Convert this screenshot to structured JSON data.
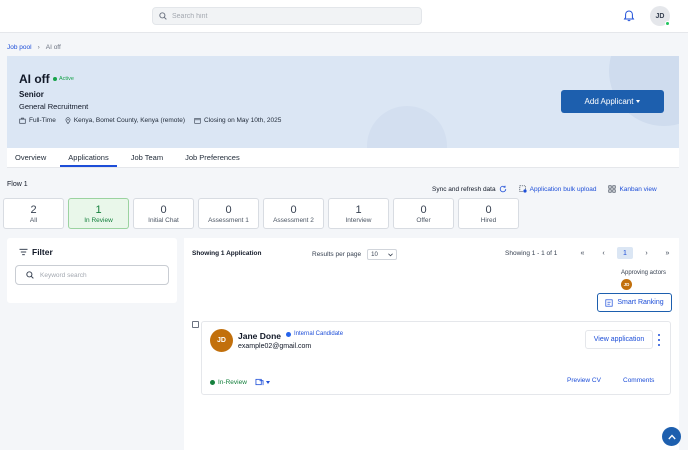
{
  "header": {
    "search_placeholder": "Search hint",
    "user_initials": "JD"
  },
  "breadcrumb": {
    "root": "Job pool",
    "separator": "›",
    "current": "AI off"
  },
  "job": {
    "title": "AI off",
    "status": "Active",
    "level": "Senior",
    "category": "General Recruitment",
    "employment_type": "Full-Time",
    "location": "Kenya, Bomet County, Kenya (remote)",
    "closing": "Closing on May 10th, 2025",
    "add_button": "Add Applicant"
  },
  "tabs": [
    {
      "label": "Overview",
      "active": false
    },
    {
      "label": "Applications",
      "active": true
    },
    {
      "label": "Job Team",
      "active": false
    },
    {
      "label": "Job Preferences",
      "active": false
    }
  ],
  "flow": {
    "label": "Flow 1",
    "sync": "Sync and refresh data",
    "bulk_upload": "Application bulk upload",
    "kanban": "Kanban view",
    "stages": [
      {
        "count": "2",
        "name": "All",
        "active": false
      },
      {
        "count": "1",
        "name": "In Review",
        "active": true
      },
      {
        "count": "0",
        "name": "Initial Chat",
        "active": false
      },
      {
        "count": "0",
        "name": "Assessment 1",
        "active": false
      },
      {
        "count": "0",
        "name": "Assessment 2",
        "active": false
      },
      {
        "count": "1",
        "name": "Interview",
        "active": false
      },
      {
        "count": "0",
        "name": "Offer",
        "active": false
      },
      {
        "count": "0",
        "name": "Hired",
        "active": false
      }
    ]
  },
  "filter": {
    "title": "Filter",
    "keyword_placeholder": "Keyword search"
  },
  "results": {
    "showing": "Showing 1 Application",
    "per_page_label": "Results per page",
    "per_page_value": "10",
    "range": "Showing 1 - 1 of 1",
    "pager": {
      "first": "«",
      "prev": "‹",
      "current": "1",
      "next": "›",
      "last": "»"
    },
    "approving_label": "Approving actors",
    "approver_initials": "JD",
    "smart_ranking": "Smart Ranking"
  },
  "applicant": {
    "initials": "JD",
    "name": "Jane Done",
    "badge": "Internal Candidate",
    "email": "example02@gmail.com",
    "view": "View application",
    "stage": "In-Review",
    "preview": "Preview CV",
    "comments": "Comments"
  },
  "colors": {
    "primary": "#1d5fae",
    "link": "#1d4ed8",
    "success": "#15803d",
    "hero_bg": "#dbe6f4",
    "avatar": "#c2700c"
  }
}
